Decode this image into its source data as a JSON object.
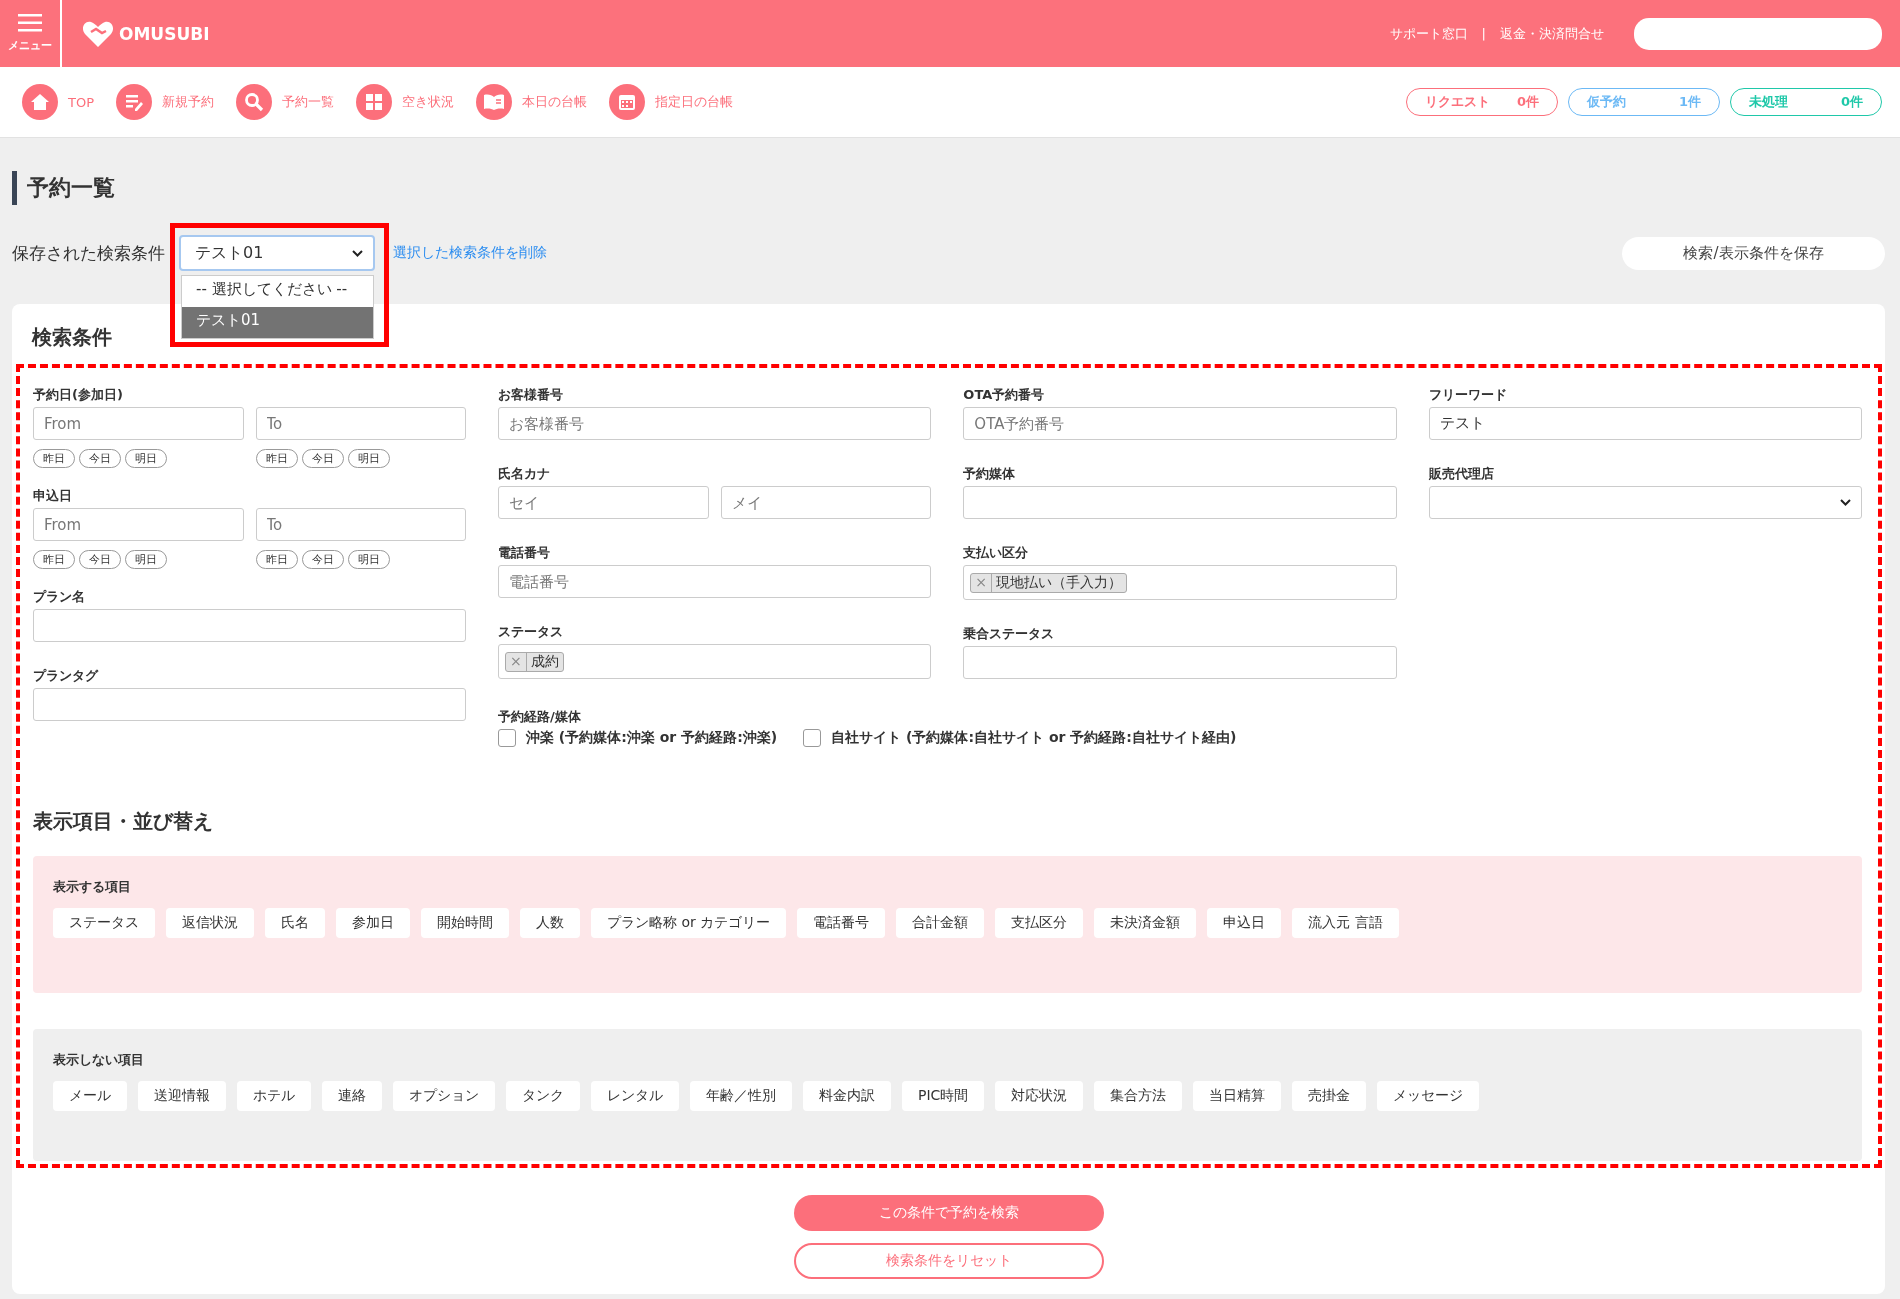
{
  "header": {
    "menu_label": "メニュー",
    "logo": "OMUSUBI",
    "links": [
      "サポート窓口",
      "返金・決済問合せ"
    ],
    "link_separator": "|"
  },
  "nav": [
    {
      "label": "TOP"
    },
    {
      "label": "新規予約"
    },
    {
      "label": "予約一覧"
    },
    {
      "label": "空き状況"
    },
    {
      "label": "本日の台帳"
    },
    {
      "label": "指定日の台帳"
    }
  ],
  "counters": [
    {
      "label": "リクエスト",
      "count": "0件",
      "color": "#fc6f7b"
    },
    {
      "label": "仮予約",
      "count": "1件",
      "color": "#6cb9f5"
    },
    {
      "label": "未処理",
      "count": "0件",
      "color": "#1fc8a9"
    }
  ],
  "page_title": "予約一覧",
  "saved_search": {
    "label": "保存された検索条件",
    "value": "テスト01",
    "options": [
      {
        "label": "-- 選択してください --",
        "selected": false
      },
      {
        "label": "テスト01",
        "selected": true
      }
    ],
    "delete_link": "選択した検索条件を削除",
    "save_button": "検索/表示条件を保存"
  },
  "search": {
    "heading": "検索条件",
    "column_1": [
      {
        "kind": "date_range",
        "label": "予約日(参加日)",
        "from_placeholder": "From",
        "to_placeholder": "To",
        "from_quick": [
          "昨日",
          "今日",
          "明日"
        ],
        "to_quick": [
          "昨日",
          "今日",
          "明日"
        ]
      },
      {
        "kind": "date_range",
        "label": "申込日",
        "from_placeholder": "From",
        "to_placeholder": "To",
        "from_quick": [
          "昨日",
          "今日",
          "明日"
        ],
        "to_quick": [
          "昨日",
          "今日",
          "明日"
        ]
      },
      {
        "kind": "text",
        "label": "プラン名"
      },
      {
        "kind": "text",
        "label": "プランタグ"
      }
    ],
    "columns": [
      [
        {
          "kind": "text",
          "label": "お客様番号",
          "placeholder": "お客様番号"
        },
        {
          "kind": "name_pair",
          "label": "氏名カナ",
          "placeholders": [
            "セイ",
            "メイ"
          ]
        },
        {
          "kind": "text",
          "label": "電話番号",
          "placeholder": "電話番号"
        },
        {
          "kind": "tags",
          "label": "ステータス",
          "tags": [
            {
              "remove": "×",
              "label": "成約"
            }
          ]
        }
      ],
      [
        {
          "kind": "text",
          "label": "OTA予約番号",
          "placeholder": "OTA予約番号"
        },
        {
          "kind": "text",
          "label": "予約媒体"
        },
        {
          "kind": "tags",
          "label": "支払い区分",
          "tags": [
            {
              "remove": "×",
              "label": "現地払い（手入力）"
            }
          ]
        },
        {
          "kind": "text",
          "label": "乗合ステータス"
        }
      ],
      [
        {
          "kind": "text",
          "label": "フリーワード",
          "value": "テスト"
        },
        {
          "kind": "select",
          "label": "販売代理店"
        }
      ]
    ],
    "route": {
      "label": "予約経路/媒体",
      "options": [
        {
          "label": "沖楽 (予約媒体:沖楽 or 予約経路:沖楽)",
          "checked": false
        },
        {
          "label": "自社サイト (予約媒体:自社サイト or 予約経路:自社サイト経由)",
          "checked": false
        }
      ]
    }
  },
  "display": {
    "heading": "表示項目・並び替え",
    "shown": {
      "label": "表示する項目",
      "items": [
        "ステータス",
        "返信状況",
        "氏名",
        "参加日",
        "開始時間",
        "人数",
        "プラン略称 or カテゴリー",
        "電話番号",
        "合計金額",
        "支払区分",
        "未決済金額",
        "申込日",
        "流入元 言語"
      ]
    },
    "hidden": {
      "label": "表示しない項目",
      "items": [
        "メール",
        "送迎情報",
        "ホテル",
        "連絡",
        "オプション",
        "タンク",
        "レンタル",
        "年齢／性別",
        "料金内訳",
        "PIC時間",
        "対応状況",
        "集合方法",
        "当日精算",
        "売掛金",
        "メッセージ"
      ]
    }
  },
  "buttons": {
    "search": "この条件で予約を検索",
    "reset": "検索条件をリセット"
  }
}
